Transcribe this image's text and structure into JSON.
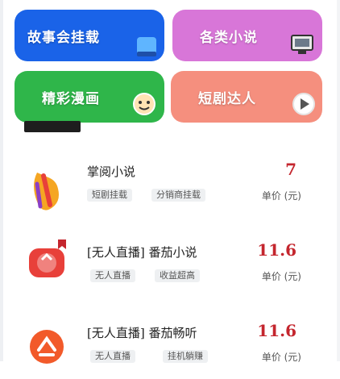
{
  "tiles": [
    {
      "label": "故事会挂载",
      "color": "#1a63e8",
      "icon": "book-icon"
    },
    {
      "label": "各类小说",
      "color": "#d876d8",
      "icon": "monitor-icon"
    },
    {
      "label": "精彩漫画",
      "color": "#2fb64a",
      "icon": "cartoon-face-icon"
    },
    {
      "label": "短剧达人",
      "color": "#f58f7e",
      "icon": "play-icon"
    }
  ],
  "items": [
    {
      "title": "掌阅小说",
      "tags": [
        "短剧挂载",
        "分销商挂载"
      ],
      "price": "7",
      "unit": "单价 (元)",
      "icon": "zhangyue-logo-icon",
      "icon_color": "#f5a623"
    },
    {
      "title": "[无人直播] 番茄小说",
      "tags": [
        "无人直播",
        "收益超高"
      ],
      "price": "11.6",
      "unit": "单价 (元)",
      "icon": "tomato-novel-logo-icon",
      "icon_color": "#e8403a"
    },
    {
      "title": "[无人直播] 番茄畅听",
      "tags": [
        "无人直播",
        "挂机躺赚"
      ],
      "price": "11.6",
      "unit": "单价 (元)",
      "icon": "tomato-listen-logo-icon",
      "icon_color": "#f25a2a"
    }
  ],
  "colors": {
    "accent_price": "#c4262e"
  }
}
